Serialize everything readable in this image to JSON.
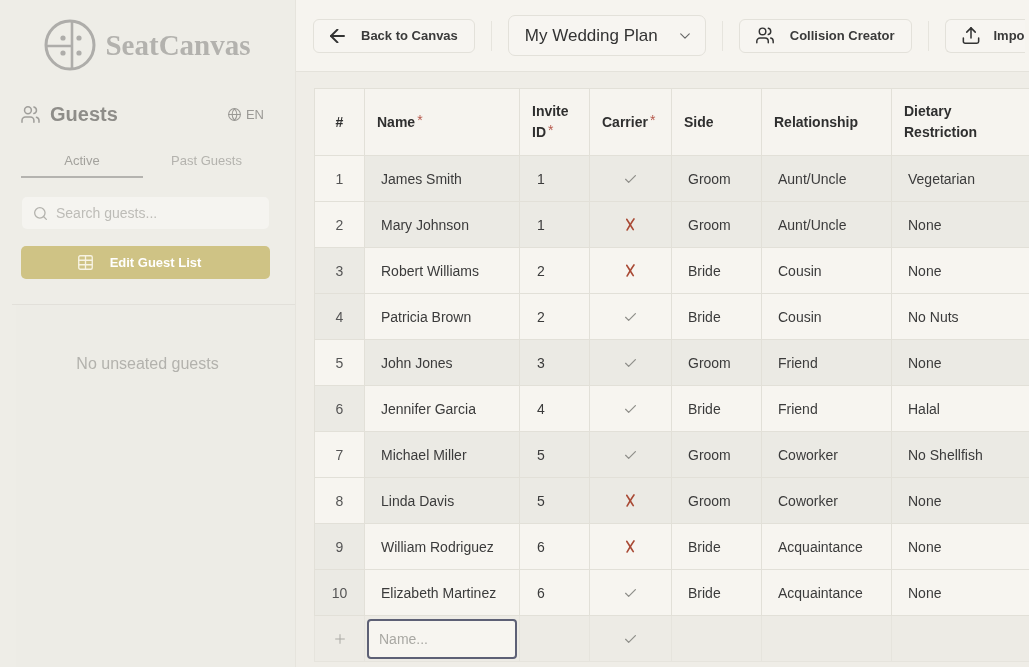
{
  "sidebar": {
    "logo": {
      "text": "SeatCanvas"
    },
    "header": {
      "title": "Guests",
      "language": "EN"
    },
    "tabs": [
      {
        "label": "Active",
        "selected": true
      },
      {
        "label": "Past Guests",
        "selected": false
      }
    ],
    "search": {
      "placeholder": "Search guests..."
    },
    "edit_button": {
      "label": "Edit Guest List"
    },
    "empty_message": "No unseated guests"
  },
  "toolbar": {
    "back_button": {
      "label": "Back to Canvas"
    },
    "plan_select": {
      "value": "My Wedding Plan"
    },
    "buttons": [
      {
        "label": "Collision Creator",
        "kind": "users"
      },
      {
        "label": "Impo",
        "kind": "upload"
      }
    ]
  },
  "table": {
    "columns": [
      {
        "label": "#"
      },
      {
        "label": "Name",
        "required_mark": "*"
      },
      {
        "label": "Invite ID",
        "required_mark": "*"
      },
      {
        "label": "Carrier",
        "required_mark": "*"
      },
      {
        "label": "Side"
      },
      {
        "label": "Relationship"
      },
      {
        "label": "Dietary Restriction"
      }
    ],
    "rows": [
      {
        "number": "1",
        "name": "James Smith",
        "invite_id": "1",
        "carrier": true,
        "side": "Groom",
        "relationship": "Aunt/Uncle",
        "dietary": "Vegetarian",
        "shaded": true
      },
      {
        "number": "2",
        "name": "Mary Johnson",
        "invite_id": "1",
        "carrier": false,
        "side": "Groom",
        "relationship": "Aunt/Uncle",
        "dietary": "None",
        "shaded": true
      },
      {
        "number": "3",
        "name": "Robert Williams",
        "invite_id": "2",
        "carrier": false,
        "side": "Bride",
        "relationship": "Cousin",
        "dietary": "None",
        "shaded": false
      },
      {
        "number": "4",
        "name": "Patricia Brown",
        "invite_id": "2",
        "carrier": true,
        "side": "Bride",
        "relationship": "Cousin",
        "dietary": "No Nuts",
        "shaded": false
      },
      {
        "number": "5",
        "name": "John Jones",
        "invite_id": "3",
        "carrier": true,
        "side": "Groom",
        "relationship": "Friend",
        "dietary": "None",
        "shaded": true
      },
      {
        "number": "6",
        "name": "Jennifer Garcia",
        "invite_id": "4",
        "carrier": true,
        "side": "Bride",
        "relationship": "Friend",
        "dietary": "Halal",
        "shaded": false
      },
      {
        "number": "7",
        "name": "Michael Miller",
        "invite_id": "5",
        "carrier": true,
        "side": "Groom",
        "relationship": "Coworker",
        "dietary": "No Shellfish",
        "shaded": true
      },
      {
        "number": "8",
        "name": "Linda Davis",
        "invite_id": "5",
        "carrier": false,
        "side": "Groom",
        "relationship": "Coworker",
        "dietary": "None",
        "shaded": true
      },
      {
        "number": "9",
        "name": "William Rodriguez",
        "invite_id": "6",
        "carrier": false,
        "side": "Bride",
        "relationship": "Acquaintance",
        "dietary": "None",
        "shaded": false
      },
      {
        "number": "10",
        "name": "Elizabeth Martinez",
        "invite_id": "6",
        "carrier": true,
        "side": "Bride",
        "relationship": "Acquaintance",
        "dietary": "None",
        "shaded": false
      }
    ],
    "new_row": {
      "placeholder": "Name...",
      "focused": true,
      "carrier": true
    }
  }
}
